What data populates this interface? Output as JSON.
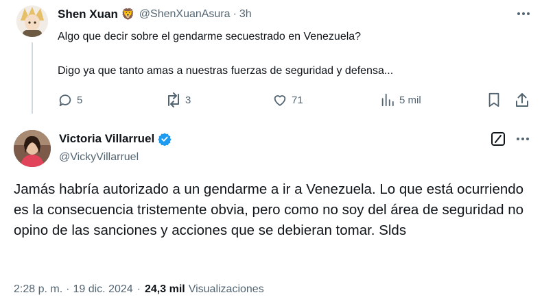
{
  "reply_tweet": {
    "display_name": "Shen Xuan",
    "badge_emoji": "🦁",
    "handle": "@ShenXuanAsura",
    "separator": "·",
    "time": "3h",
    "text_line1": "Algo que decir sobre el gendarme secuestrado en Venezuela?",
    "text_line2": "Digo ya que tanto amas a nuestras fuerzas de seguridad y defensa...",
    "replies": "5",
    "retweets": "3",
    "likes": "71",
    "views": "5 mil"
  },
  "main_tweet": {
    "display_name": "Victoria Villarruel",
    "handle": "@VickyVillarruel",
    "verified_color": "#1d9bf0",
    "text": "Jamás habría autorizado a un gendarme a ir a Venezuela. Lo que está ocurriendo es la consecuencia tristemente obvia, pero como no soy del área de seguridad no opino de las sanciones y acciones que se debieran tomar. Slds",
    "time": "2:28 p. m.",
    "dot1": "·",
    "date": "19 dic. 2024",
    "dot2": "·",
    "views_count": "24,3 mil",
    "views_label": "Visualizaciones"
  },
  "icons": [
    "more-icon",
    "reply-icon",
    "retweet-icon",
    "like-icon",
    "views-icon",
    "bookmark-icon",
    "share-icon",
    "verified-icon",
    "grok-icon"
  ]
}
